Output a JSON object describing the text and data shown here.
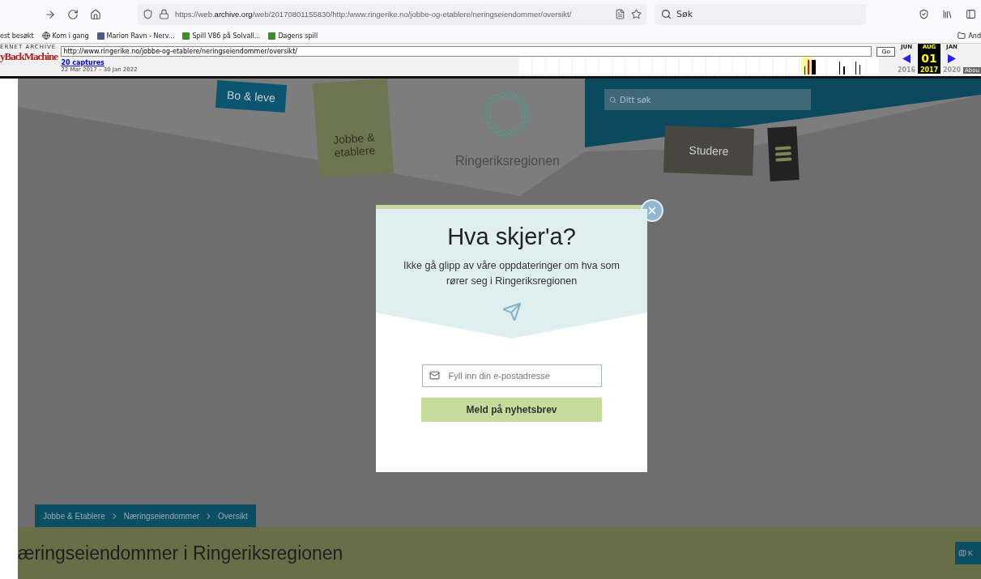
{
  "browser": {
    "address": "https://web.**archive.org**/web/20170801155830/http:/www.ringerike.no/jobbe-og-etablere/neringseiendommer/oversikt/",
    "search_placeholder": "Søk",
    "bookmarks": [
      {
        "label": "est besøkt",
        "kind": "plain"
      },
      {
        "label": "Kom i gang",
        "kind": "globe"
      },
      {
        "label": "Marion Ravn - Nerv...",
        "kind": "person"
      },
      {
        "label": "Spill V86 på Solvall...",
        "kind": "green"
      },
      {
        "label": "Dagens spill",
        "kind": "green"
      }
    ],
    "other_bookmarks": "And"
  },
  "wayback": {
    "logo_top": "ERNET ARCHIVE",
    "logo": "yBackMachine",
    "url": "http://www.ringerike.no/jobbe-og-etablere/neringseiendommer/oversikt/",
    "go": "Go",
    "captures": "20 captures",
    "range": "22 Mar 2017 – 30 Jan 2022",
    "months": [
      {
        "month": "JUN",
        "year": "2016",
        "selected": false
      },
      {
        "month": "AUG",
        "day": "01",
        "year": "2017",
        "selected": true
      },
      {
        "month": "JAN",
        "year": "2020",
        "selected": false
      }
    ],
    "about": "Abou"
  },
  "site": {
    "nav": [
      {
        "label": "Bo & leve",
        "kind": "blue"
      },
      {
        "label": "Jobbe & etablere",
        "kind": "green"
      },
      {
        "label": "Studere",
        "kind": "dark"
      }
    ],
    "logo": "Ringeriksregionen",
    "search_placeholder": "Ditt søk",
    "breadcrumb": [
      "Jobbe & Etablere",
      "Næringseiendommer",
      "Oversikt"
    ],
    "heading": "æringseiendommer i Ringeriksregionen",
    "side_button": "K"
  },
  "modal": {
    "title": "Hva skjer'a?",
    "text": "Ikke gå glipp av våre oppdateringer om hva som rører seg i Ringeriksregionen",
    "email_placeholder": "Fyll inn din e-postadresse",
    "button": "Meld på nyhetsbrev"
  }
}
